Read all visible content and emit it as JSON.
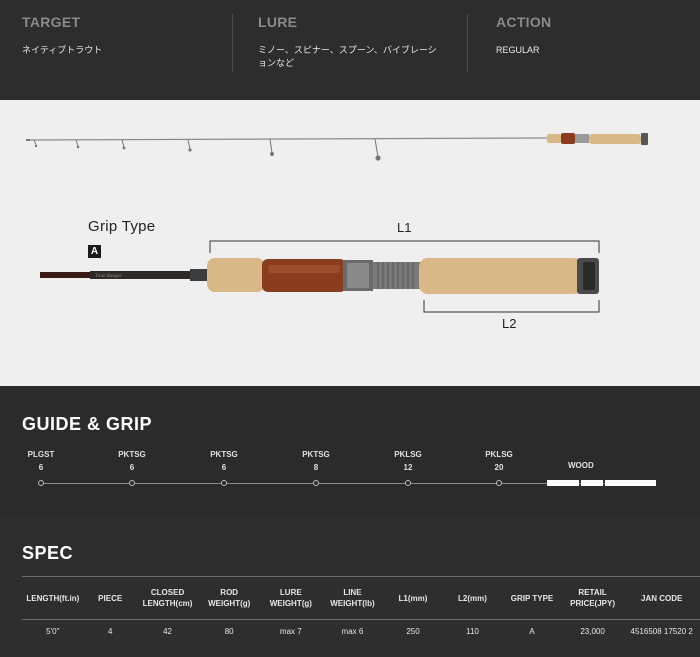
{
  "info": {
    "target": {
      "heading": "TARGET",
      "value": "ネイティブトラウト"
    },
    "lure": {
      "heading": "LURE",
      "value": "ミノー、スピナー、スプーン、バイブレーションなど"
    },
    "action": {
      "heading": "ACTION",
      "value": "REGULAR"
    }
  },
  "rod_image": {
    "grip_type_label": "Grip Type",
    "grip_type_value": "A",
    "l1_label": "L1",
    "l2_label": "L2"
  },
  "guide": {
    "title": "GUIDE & GRIP",
    "guides": [
      {
        "name": "PLGST",
        "size": "6"
      },
      {
        "name": "PKTSG",
        "size": "6"
      },
      {
        "name": "PKTSG",
        "size": "6"
      },
      {
        "name": "PKTSG",
        "size": "8"
      },
      {
        "name": "PKLSG",
        "size": "12"
      },
      {
        "name": "PKLSG",
        "size": "20"
      }
    ],
    "grip_label": "WOOD"
  },
  "spec": {
    "title": "SPEC",
    "headers": [
      "LENGTH(ft.in)",
      "PIECE",
      "CLOSED LENGTH(cm)",
      "ROD WEIGHT(g)",
      "LURE WEIGHT(g)",
      "LINE WEIGHT(lb)",
      "L1(mm)",
      "L2(mm)",
      "GRIP TYPE",
      "RETAIL PRICE(JPY)",
      "JAN CODE"
    ],
    "row": [
      "5'0\"",
      "4",
      "42",
      "80",
      "max 7",
      "max 6",
      "250",
      "110",
      "A",
      "23,000",
      "4516508 17520 2"
    ]
  },
  "colors": {
    "dark_bg": "#2b2b2b",
    "image_bg": "#efefef",
    "cork": "#d9b887",
    "burl_wood": "#8a3c1f"
  }
}
